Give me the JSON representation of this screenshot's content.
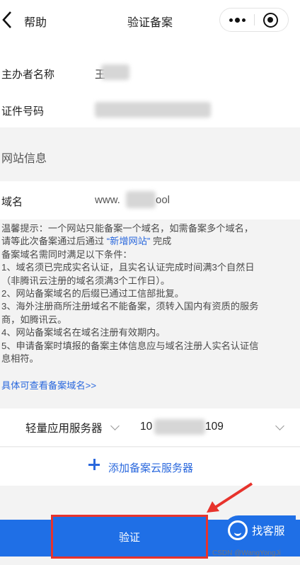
{
  "header": {
    "back_label": "帮助",
    "title": "验证备案"
  },
  "info": {
    "organizer_label": "主办者名称",
    "organizer_value_prefix": "王",
    "id_label": "证件号码"
  },
  "website_section": {
    "title": "网站信息"
  },
  "domain": {
    "label": "域名",
    "value_prefix": "www.",
    "value_suffix": "ool"
  },
  "notice": {
    "line1": "温馨提示：一个网站只能备案一个域名，如需备案多个域名，",
    "line2_prefix": "请等此次备案通过后通过",
    "line2_link": "“新增网站”",
    "line2_suffix": "完成",
    "line3": "备案域名需同时满足以下条件：",
    "line4": "1、域名须已完成实名认证，且实名认证完成时间满3个自然日",
    "line5": "（非腾讯云注册的域名须满3个工作日）。",
    "line6": "2、网站备案域名的后缀已通过工信部批复。",
    "line7": "3、海外注册商所注册域名不能备案，须转入国内有资质的服务",
    "line8": "商，如腾讯云。",
    "line9": "4、网站备案域名在域名注册有效期内。",
    "line10": "5、申请备案时填报的备案主体信息应与域名注册人实名认证信",
    "line11": "息相符。",
    "link": "具体可查看备案域名>>"
  },
  "server": {
    "type": "轻量应用服务器",
    "ip_prefix": "10",
    "ip_suffix": "109"
  },
  "add_server": {
    "label": "添加备案云服务器"
  },
  "footer": {
    "verify_label": "验证",
    "service_label": "找客服"
  },
  "watermark": "CSDN @WangYongJi",
  "colors": {
    "accent": "#2a68dd",
    "button_blue": "#1f6fe6",
    "annotation_red": "#e7332c"
  }
}
